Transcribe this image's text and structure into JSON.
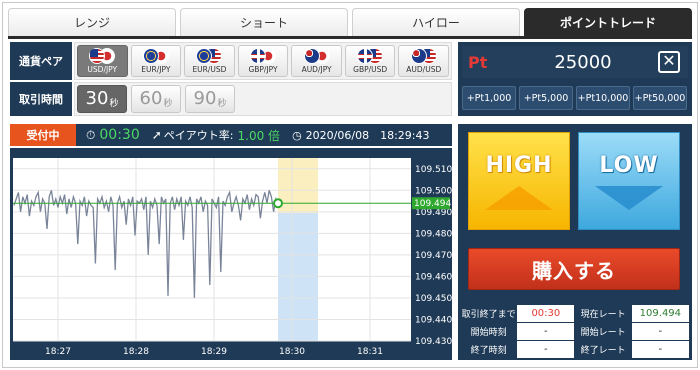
{
  "tabs": [
    {
      "label": "レンジ",
      "active": false
    },
    {
      "label": "ショート",
      "active": false
    },
    {
      "label": "ハイロー",
      "active": false
    },
    {
      "label": "ポイントトレード",
      "active": true
    }
  ],
  "pairs_label": "通貨ペア",
  "pairs": [
    {
      "code": "USD/JPY",
      "flag_a": "usd",
      "flag_b": "jpy",
      "active": true
    },
    {
      "code": "EUR/JPY",
      "flag_a": "eur",
      "flag_b": "jpy",
      "active": false
    },
    {
      "code": "EUR/USD",
      "flag_a": "eur",
      "flag_b": "usd",
      "active": false
    },
    {
      "code": "GBP/JPY",
      "flag_a": "gbp",
      "flag_b": "jpy",
      "active": false
    },
    {
      "code": "AUD/JPY",
      "flag_a": "aud",
      "flag_b": "jpy",
      "active": false
    },
    {
      "code": "GBP/USD",
      "flag_a": "gbp",
      "flag_b": "usd",
      "active": false
    },
    {
      "code": "AUD/USD",
      "flag_a": "aud",
      "flag_b": "usd",
      "active": false
    }
  ],
  "time_label": "取引時間",
  "times": [
    {
      "value": "30",
      "unit": "秒",
      "active": true
    },
    {
      "value": "60",
      "unit": "秒",
      "active": false
    },
    {
      "value": "90",
      "unit": "秒",
      "active": false
    }
  ],
  "points": {
    "label": "Pt",
    "value": "25000",
    "close_glyph": "✕",
    "adds": [
      "+Pt1,000",
      "+Pt5,000",
      "+Pt10,000",
      "+Pt50,000"
    ]
  },
  "status": {
    "accepting": "受付中",
    "countdown": "00:30",
    "payout_label": "ペイアウト率:",
    "payout_value": "1.00 倍",
    "datetime": "2020/06/08　18:29:43"
  },
  "trade": {
    "high": "HIGH",
    "low": "LOW",
    "buy": "購入する"
  },
  "info": {
    "rows": [
      {
        "k1": "取引終了まで",
        "v1": "00:30",
        "k2": "現在レート",
        "v2": "109.494"
      },
      {
        "k1": "開始時刻",
        "v1": "-",
        "k2": "開始レート",
        "v2": "-"
      },
      {
        "k1": "終了時刻",
        "v1": "-",
        "k2": "終了レート",
        "v2": "-"
      }
    ]
  },
  "colors": {
    "navy": "#1f3a56",
    "accent_orange": "#e8541d",
    "positive_green": "#4cd964",
    "price_line": "#7a8499",
    "current_line": "#2ea82e",
    "future_zone": "#cfe3f6",
    "entry_zone": "#fbeebf"
  },
  "chart_data": {
    "type": "line",
    "current_rate": 109.494,
    "ylim": [
      109.43,
      109.515
    ],
    "yticks": [
      109.51,
      109.5,
      109.49,
      109.48,
      109.47,
      109.46,
      109.45,
      109.44,
      109.43
    ],
    "xticks": [
      "18:27",
      "18:28",
      "18:29",
      "18:30",
      "18:31"
    ],
    "series": [
      {
        "values": [
          109.493,
          109.496,
          109.499,
          109.49,
          109.497,
          109.494,
          109.498,
          109.488,
          109.495,
          109.493,
          109.497,
          109.499,
          109.49,
          109.496,
          109.494,
          109.482,
          109.497,
          109.5,
          109.493,
          109.496,
          109.492,
          109.497,
          109.494,
          109.498,
          109.489,
          109.496,
          109.492,
          109.497,
          109.494,
          109.475,
          109.495,
          109.493,
          109.497,
          109.488,
          109.495,
          109.493,
          109.492,
          109.466,
          109.496,
          109.494,
          109.497,
          109.492,
          109.495,
          109.49,
          109.497,
          109.493,
          109.463,
          109.494,
          109.497,
          109.492,
          109.495,
          109.484,
          109.496,
          109.493,
          109.497,
          109.479,
          109.495,
          109.494,
          109.496,
          109.491,
          109.497,
          109.47,
          109.495,
          109.492,
          109.496,
          109.493,
          109.475,
          109.497,
          109.494,
          109.496,
          109.451,
          109.494,
          109.497,
          109.491,
          109.496,
          109.493,
          109.497,
          109.477,
          109.495,
          109.493,
          109.497,
          109.492,
          109.45,
          109.496,
          109.494,
          109.497,
          109.49,
          109.495,
          109.493,
          109.456,
          109.496,
          109.494,
          109.492,
          109.497,
          109.462,
          109.495,
          109.493,
          109.497,
          109.499,
          109.49,
          109.494,
          109.497,
          109.493,
          109.486,
          109.496,
          109.494,
          109.498,
          109.491,
          109.496,
          109.493,
          109.498,
          109.497,
          109.487,
          109.495,
          109.499,
          109.494,
          109.5,
          109.497,
          109.49,
          109.496,
          109.494
        ]
      }
    ]
  }
}
